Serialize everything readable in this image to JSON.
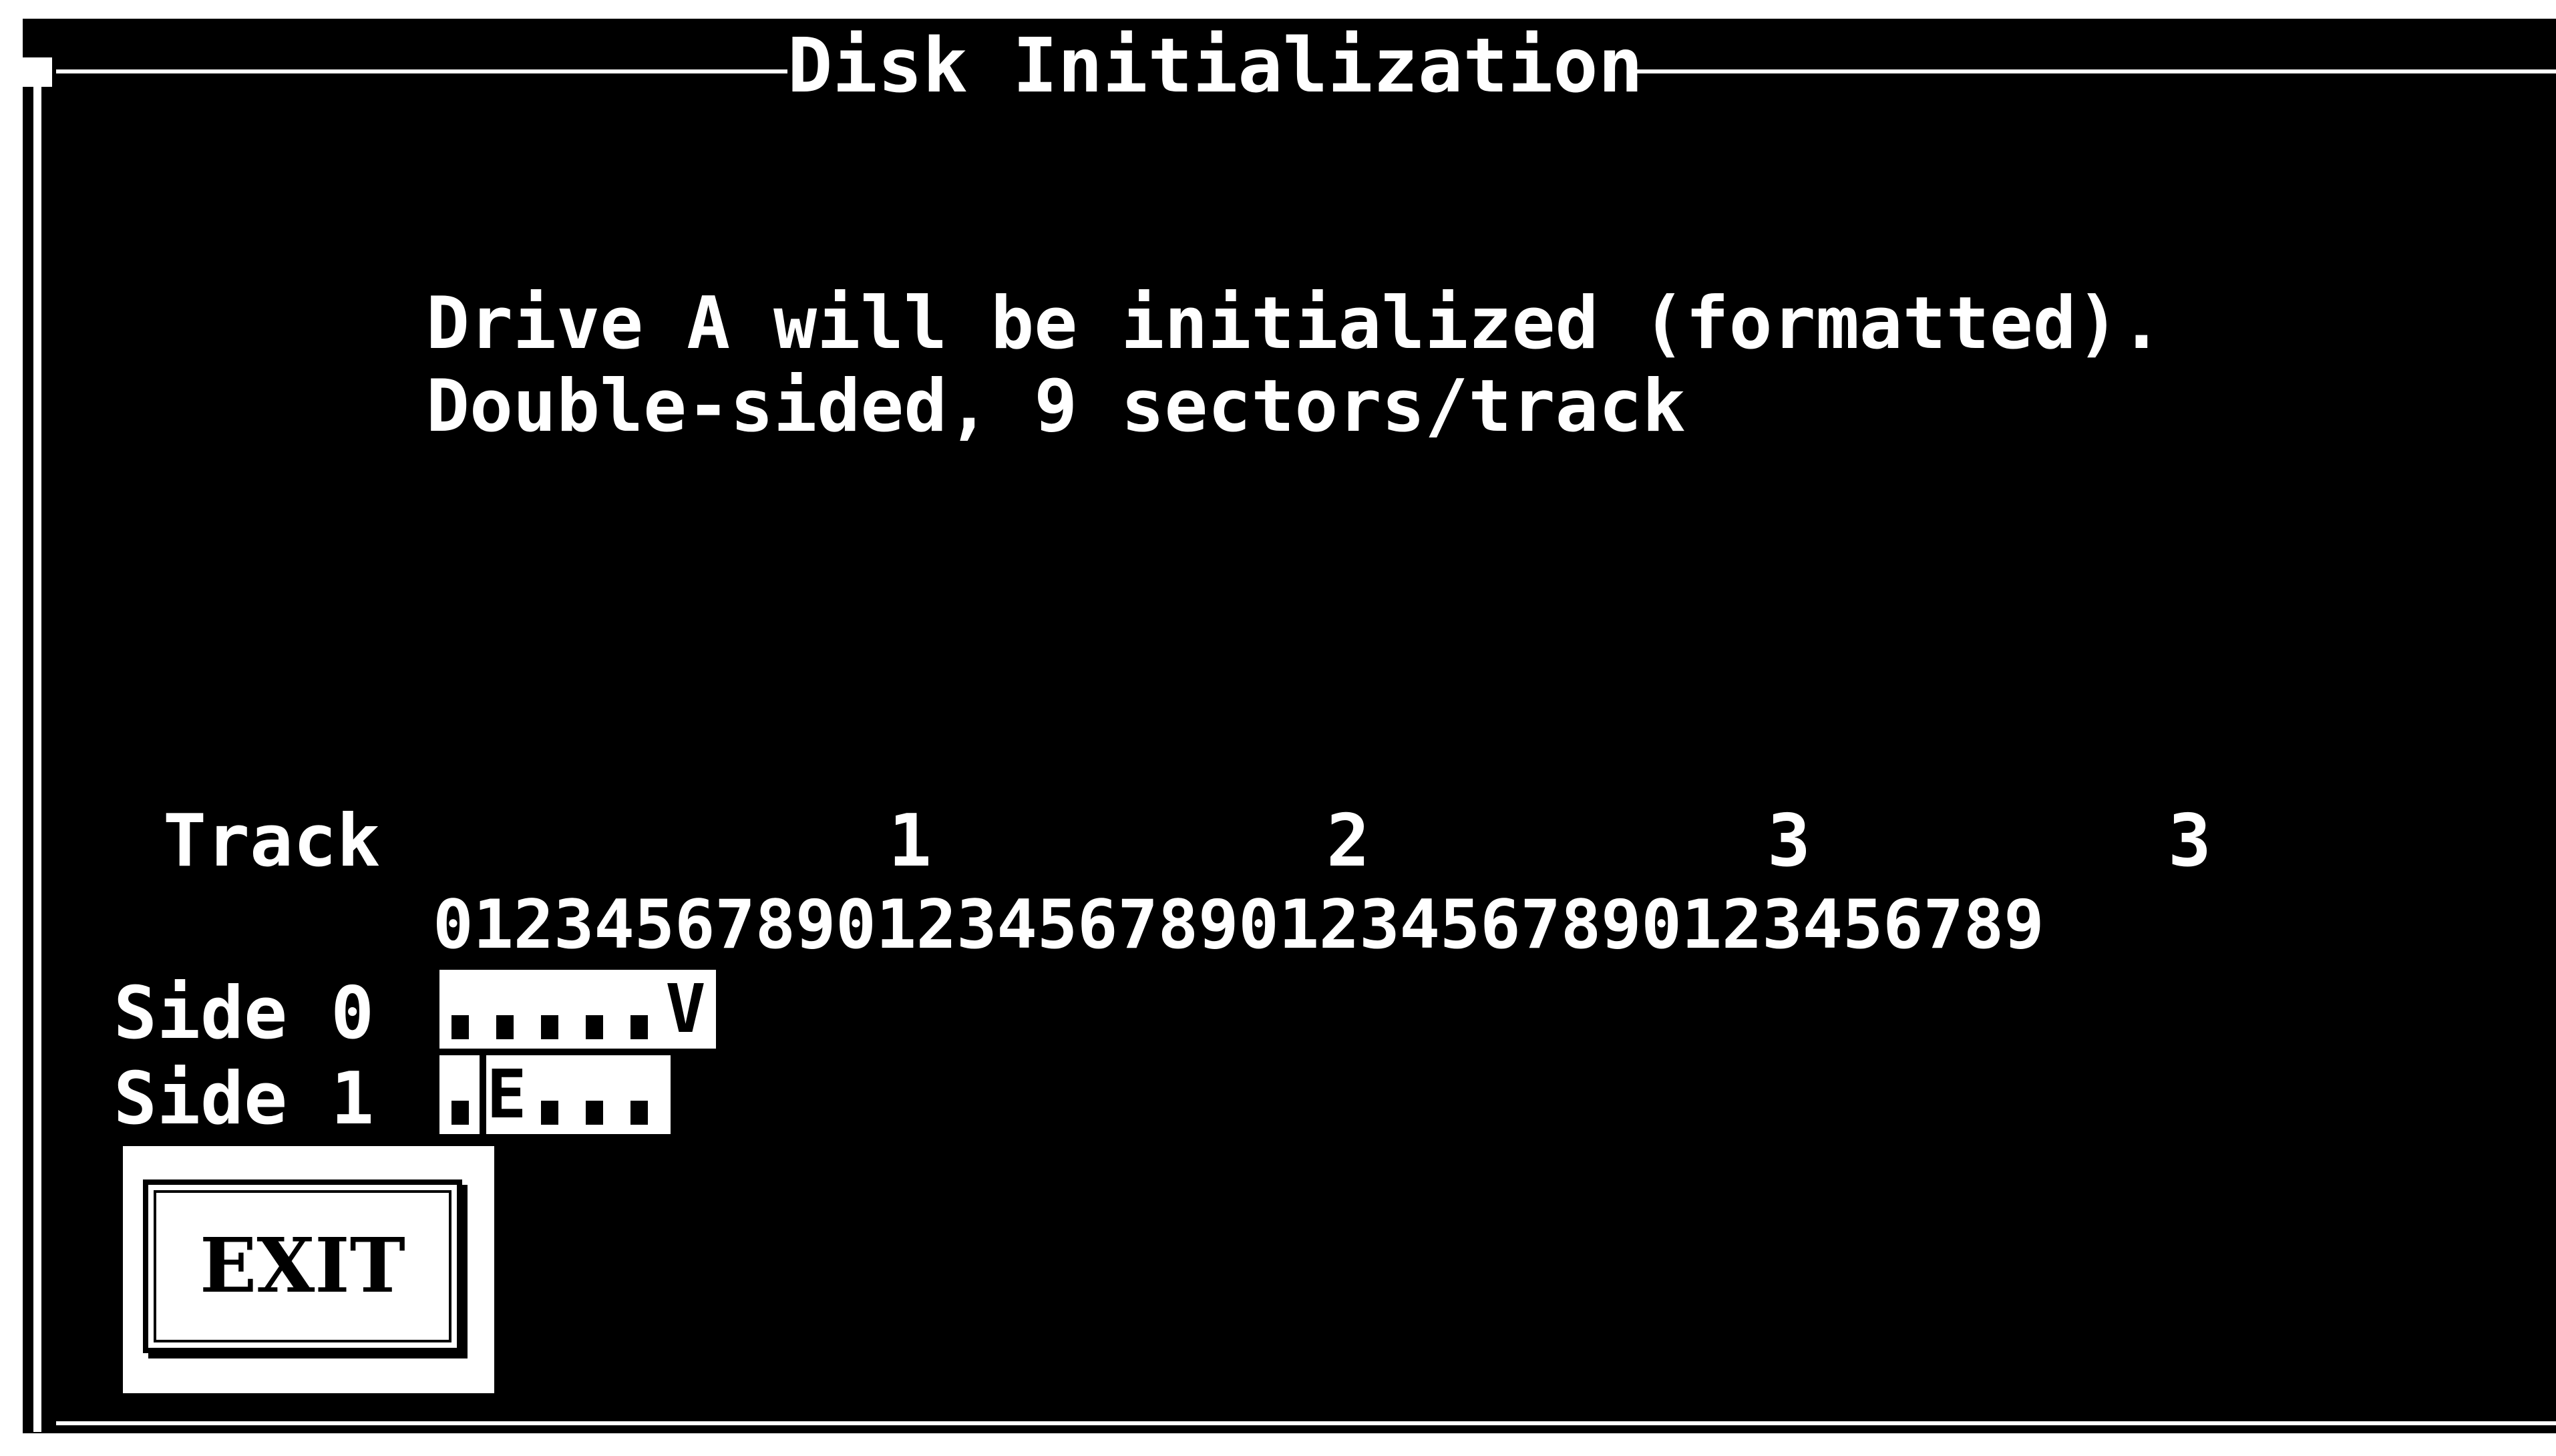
{
  "window": {
    "title": "Disk Initialization",
    "close_icon": "close-box-icon"
  },
  "message": {
    "line1": "Drive A will be initialized (formatted).",
    "line2": "Double-sided, 9 sectors/track"
  },
  "track_grid": {
    "label": "Track",
    "tens": [
      "1",
      "2",
      "3",
      "3"
    ],
    "units": "0123456789012345678901234567890123456789"
  },
  "sides": [
    {
      "label": "Side 0",
      "cells": [
        ".",
        ".",
        ".",
        ".",
        ".",
        "V"
      ]
    },
    {
      "label": "Side 1",
      "cells": [
        ".",
        "E",
        ".",
        ".",
        "."
      ]
    }
  ],
  "buttons": {
    "exit_label": "EXIT"
  },
  "colors": {
    "background": "#000000",
    "foreground": "#ffffff"
  }
}
